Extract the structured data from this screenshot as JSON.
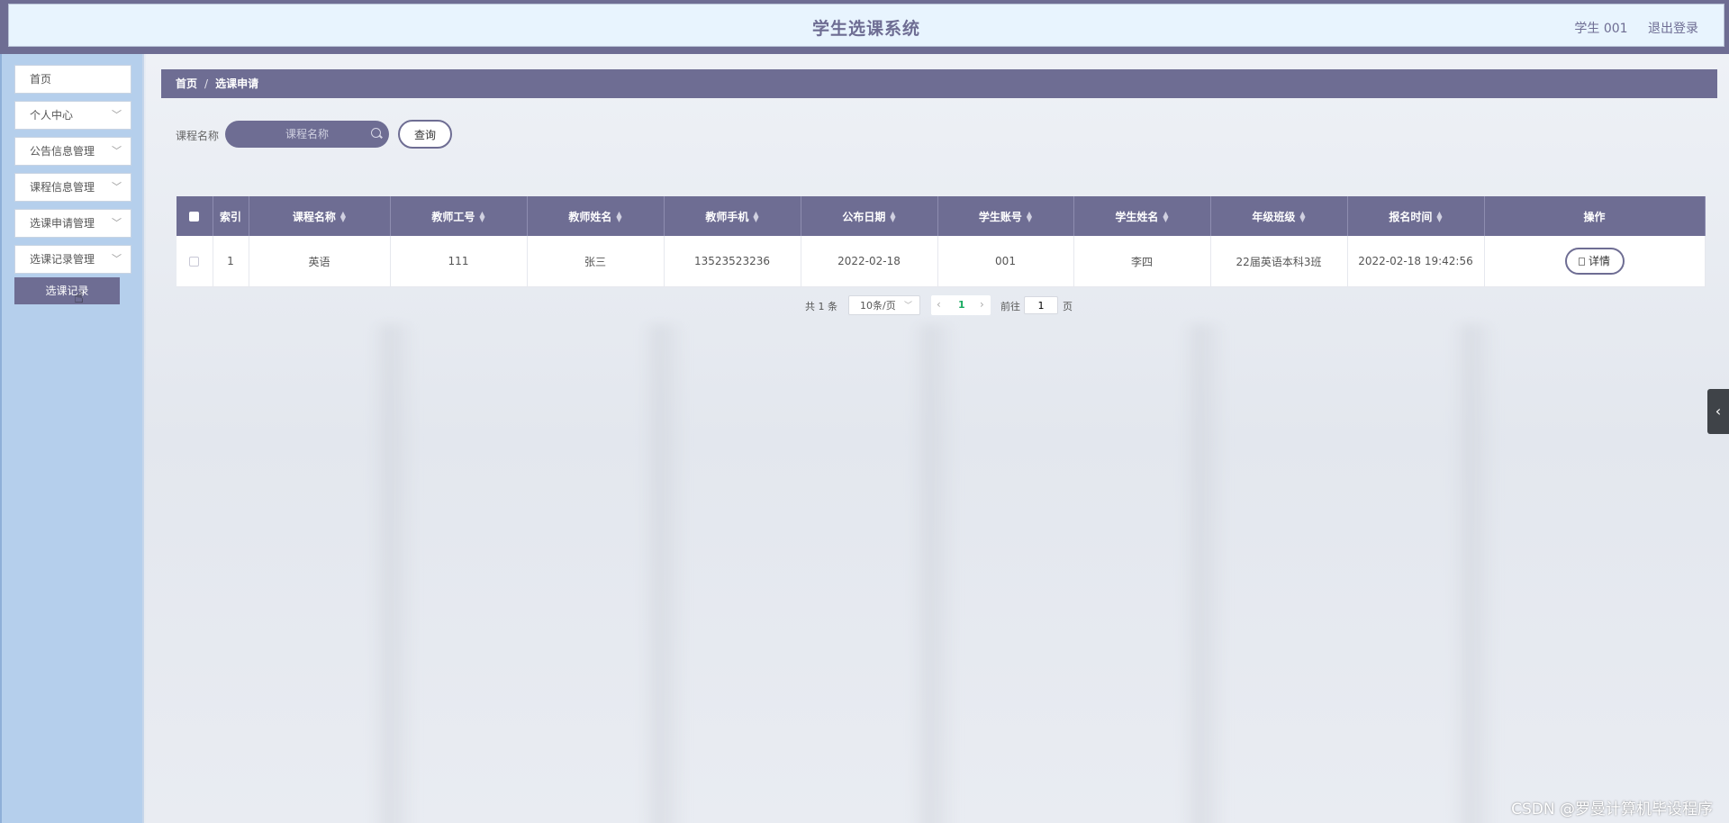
{
  "header": {
    "title": "学生选课系统",
    "user": "学生 001",
    "logout": "退出登录"
  },
  "sidebar": {
    "items": [
      {
        "label": "首页",
        "has_chevron": false
      },
      {
        "label": "个人中心",
        "has_chevron": true
      },
      {
        "label": "公告信息管理",
        "has_chevron": true
      },
      {
        "label": "课程信息管理",
        "has_chevron": true
      },
      {
        "label": "选课申请管理",
        "has_chevron": true
      },
      {
        "label": "选课记录管理",
        "has_chevron": true
      }
    ],
    "submenu_active": "选课记录"
  },
  "breadcrumb": {
    "home": "首页",
    "separator": "/",
    "current": "选课申请"
  },
  "search": {
    "label": "课程名称",
    "placeholder": "课程名称",
    "query_button": "查询"
  },
  "table": {
    "columns": [
      "索引",
      "课程名称",
      "教师工号",
      "教师姓名",
      "教师手机",
      "公布日期",
      "学生账号",
      "学生姓名",
      "年级班级",
      "报名时间",
      "操作"
    ],
    "rows": [
      {
        "index": "1",
        "course_name": "英语",
        "teacher_id": "111",
        "teacher_name": "张三",
        "teacher_phone": "13523523236",
        "publish_date": "2022-02-18",
        "student_account": "001",
        "student_name": "李四",
        "grade_class": "22届英语本科3班",
        "apply_time": "2022-02-18 19:42:56",
        "action": "详情"
      }
    ]
  },
  "pagination": {
    "total": "共 1 条",
    "page_size": "10条/页",
    "current_page": "1",
    "goto_label": "前往",
    "goto_value": "1",
    "goto_suffix": "页"
  },
  "watermark": "CSDN @罗曼计算机毕设程序",
  "colors": {
    "primary": "#6e6d93",
    "sidebar_bg": "#b5cfec",
    "header_bg": "#e8f4fe",
    "active_page": "#1aab62"
  }
}
